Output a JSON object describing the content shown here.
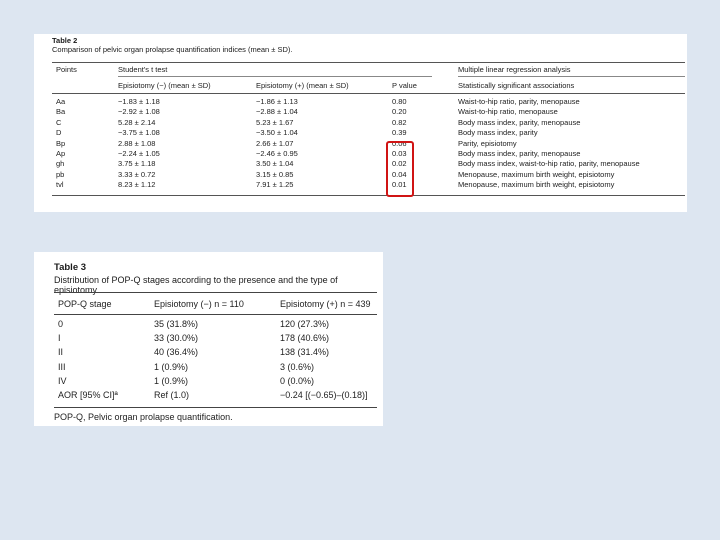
{
  "table2": {
    "label": "Table 2",
    "caption": "Comparison of pelvic organ prolapse quantification indices (mean ± SD).",
    "group_headers": {
      "points": "Points",
      "students_t": "Student's t test",
      "regression": "Multiple linear regression analysis"
    },
    "sub_headers": {
      "epi_minus": "Episiotomy (−) (mean ± SD)",
      "epi_plus": "Episiotomy (+) (mean ± SD)",
      "p_value": "P value",
      "associations": "Statistically significant associations"
    },
    "rows": [
      {
        "point": "Aa",
        "minus": "−1.83 ± 1.18",
        "plus": "−1.86 ± 1.13",
        "p": "0.80",
        "assoc": "Waist-to-hip ratio, parity, menopause"
      },
      {
        "point": "Ba",
        "minus": "−2.92 ± 1.08",
        "plus": "−2.88 ± 1.04",
        "p": "0.20",
        "assoc": "Waist-to-hip ratio, menopause"
      },
      {
        "point": "C",
        "minus": "5.28 ± 2.14",
        "plus": "5.23 ± 1.67",
        "p": "0.82",
        "assoc": "Body mass index, parity, menopause"
      },
      {
        "point": "D",
        "minus": "−3.75 ± 1.08",
        "plus": "−3.50 ± 1.04",
        "p": "0.39",
        "assoc": "Body mass index, parity"
      },
      {
        "point": "Bp",
        "minus": "2.88 ± 1.08",
        "plus": "2.66 ± 1.07",
        "p": "0.06",
        "assoc": "Parity, episiotomy"
      },
      {
        "point": "Ap",
        "minus": "−2.24 ± 1.05",
        "plus": "−2.46 ± 0.95",
        "p": "0.03",
        "assoc": "Body mass index, parity, menopause"
      },
      {
        "point": "gh",
        "minus": "3.75 ± 1.18",
        "plus": "3.50 ± 1.04",
        "p": "0.02",
        "assoc": "Body mass index, waist-to-hip ratio, parity, menopause"
      },
      {
        "point": "pb",
        "minus": "3.33 ± 0.72",
        "plus": "3.15 ± 0.85",
        "p": "0.04",
        "assoc": "Menopause, maximum birth weight, episiotomy"
      },
      {
        "point": "tvl",
        "minus": "8.23 ± 1.12",
        "plus": "7.91 ± 1.25",
        "p": "0.01",
        "assoc": "Menopause, maximum birth weight, episiotomy"
      }
    ],
    "highlight_color": "#d01414"
  },
  "table3": {
    "label": "Table 3",
    "caption": "Distribution of POP-Q stages according to the presence and the type of episiotomy.",
    "headers": {
      "stage": "POP-Q stage",
      "minus": "Episiotomy (−) n = 110",
      "plus": "Episiotomy (+) n = 439"
    },
    "rows": [
      {
        "stage": "0",
        "minus": "35 (31.8%)",
        "plus": "120 (27.3%)"
      },
      {
        "stage": "I",
        "minus": "33 (30.0%)",
        "plus": "178 (40.6%)"
      },
      {
        "stage": "II",
        "minus": "40 (36.4%)",
        "plus": "138 (31.4%)"
      },
      {
        "stage": "III",
        "minus": "1 (0.9%)",
        "plus": "3 (0.6%)"
      },
      {
        "stage": "IV",
        "minus": "1 (0.9%)",
        "plus": "0 (0.0%)"
      },
      {
        "stage": "AOR [95% CI]ª",
        "minus": "Ref (1.0)",
        "plus": "−0.24 [(−0.65)–(0.18)]"
      }
    ],
    "footnote": "POP-Q, Pelvic organ prolapse quantification."
  }
}
